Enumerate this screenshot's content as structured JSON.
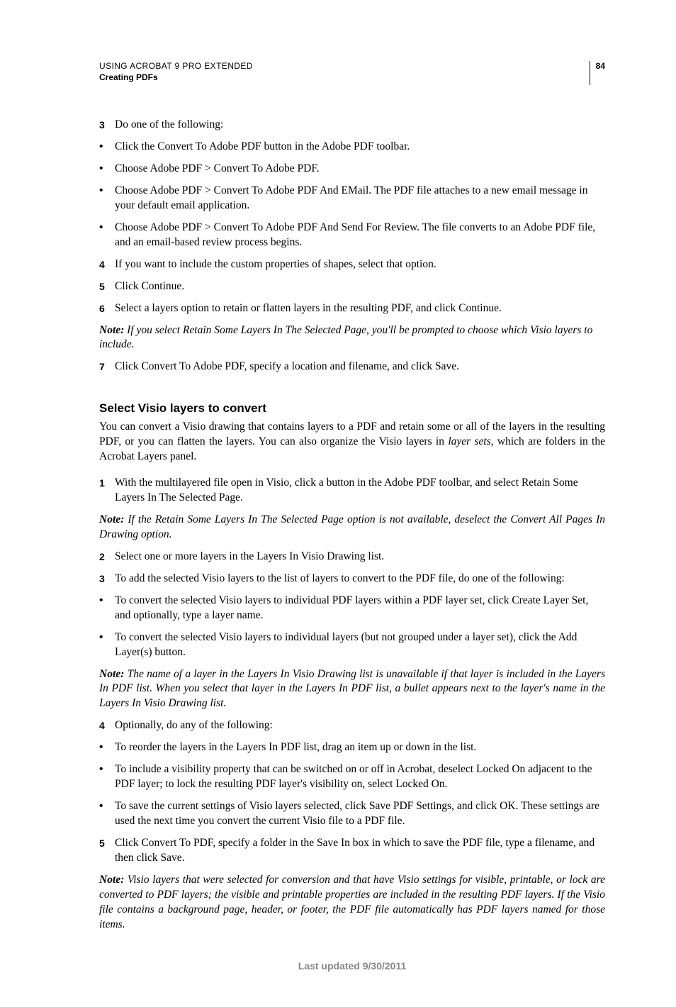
{
  "header": {
    "title": "USING ACROBAT 9 PRO EXTENDED",
    "subtitle": "Creating PDFs",
    "page_number": "84"
  },
  "section1": {
    "step3_marker": "3",
    "step3": "Do one of the following:",
    "bullets1": [
      "Click the Convert To Adobe PDF button in the Adobe PDF toolbar.",
      "Choose Adobe PDF > Convert To Adobe PDF.",
      "Choose Adobe PDF > Convert To Adobe PDF And EMail. The PDF file attaches to a new email message in your default email application.",
      "Choose Adobe PDF > Convert To Adobe PDF And Send For Review. The file converts to an Adobe PDF file, and an email-based review process begins."
    ],
    "step4_marker": "4",
    "step4": "If you want to include the custom properties of shapes, select that option.",
    "step5_marker": "5",
    "step5": "Click Continue.",
    "step6_marker": "6",
    "step6": "Select a layers option to retain or flatten layers in the resulting PDF, and click Continue.",
    "note1_label": "Note:",
    "note1": " If you select Retain Some Layers In The Selected Page, you'll be prompted to choose which Visio layers to include.",
    "step7_marker": "7",
    "step7": "Click Convert To Adobe PDF, specify a location and filename, and click Save."
  },
  "section2": {
    "heading": "Select Visio layers to convert",
    "intro_a": "You can convert a Visio drawing that contains layers to a PDF and retain some or all of the layers in the resulting PDF, or you can flatten the layers. You can also organize the Visio layers in ",
    "intro_em": "layer sets",
    "intro_b": ", which are folders in the Acrobat Layers panel.",
    "step1_marker": "1",
    "step1": "With the multilayered file open in Visio, click a button in the Adobe PDF toolbar, and select Retain Some Layers In The Selected Page.",
    "note2_label": "Note:",
    "note2": " If the Retain Some Layers In The Selected Page option is not available, deselect the Convert All Pages In Drawing option.",
    "step2_marker": "2",
    "step2": "Select one or more layers in the Layers In Visio Drawing list.",
    "step3_marker": "3",
    "step3": "To add the selected Visio layers to the list of layers to convert to the PDF file, do one of the following:",
    "bullets2": [
      "To convert the selected Visio layers to individual PDF layers within a PDF layer set, click Create Layer Set, and optionally, type a layer name.",
      "To convert the selected Visio layers to individual layers (but not grouped under a layer set), click the Add Layer(s) button."
    ],
    "note3_label": "Note:",
    "note3": " The name of a layer in the Layers In Visio Drawing list is unavailable if that layer is included in the Layers In PDF list. When you select that layer in the Layers In PDF list, a bullet appears next to the layer's name in the Layers In Visio Drawing list.",
    "step4_marker": "4",
    "step4": "Optionally, do any of the following:",
    "bullets3": [
      "To reorder the layers in the Layers In PDF list, drag an item up or down in the list.",
      "To include a visibility property that can be switched on or off in Acrobat, deselect Locked On adjacent to the PDF layer; to lock the resulting PDF layer's visibility on, select Locked On.",
      "To save the current settings of Visio layers selected, click Save PDF Settings, and click OK. These settings are used the next time you convert the current Visio file to a PDF file."
    ],
    "step5_marker": "5",
    "step5": "Click Convert To PDF, specify a folder in the Save In box in which to save the PDF file, type a filename, and then click Save.",
    "note4_label": "Note:",
    "note4": " Visio layers that were selected for conversion and that have Visio settings for visible, printable, or lock are converted to PDF layers; the visible and printable properties are included in the resulting PDF layers. If the Visio file contains a background page, header, or footer, the PDF file automatically has PDF layers named for those items."
  },
  "footer": "Last updated 9/30/2011"
}
